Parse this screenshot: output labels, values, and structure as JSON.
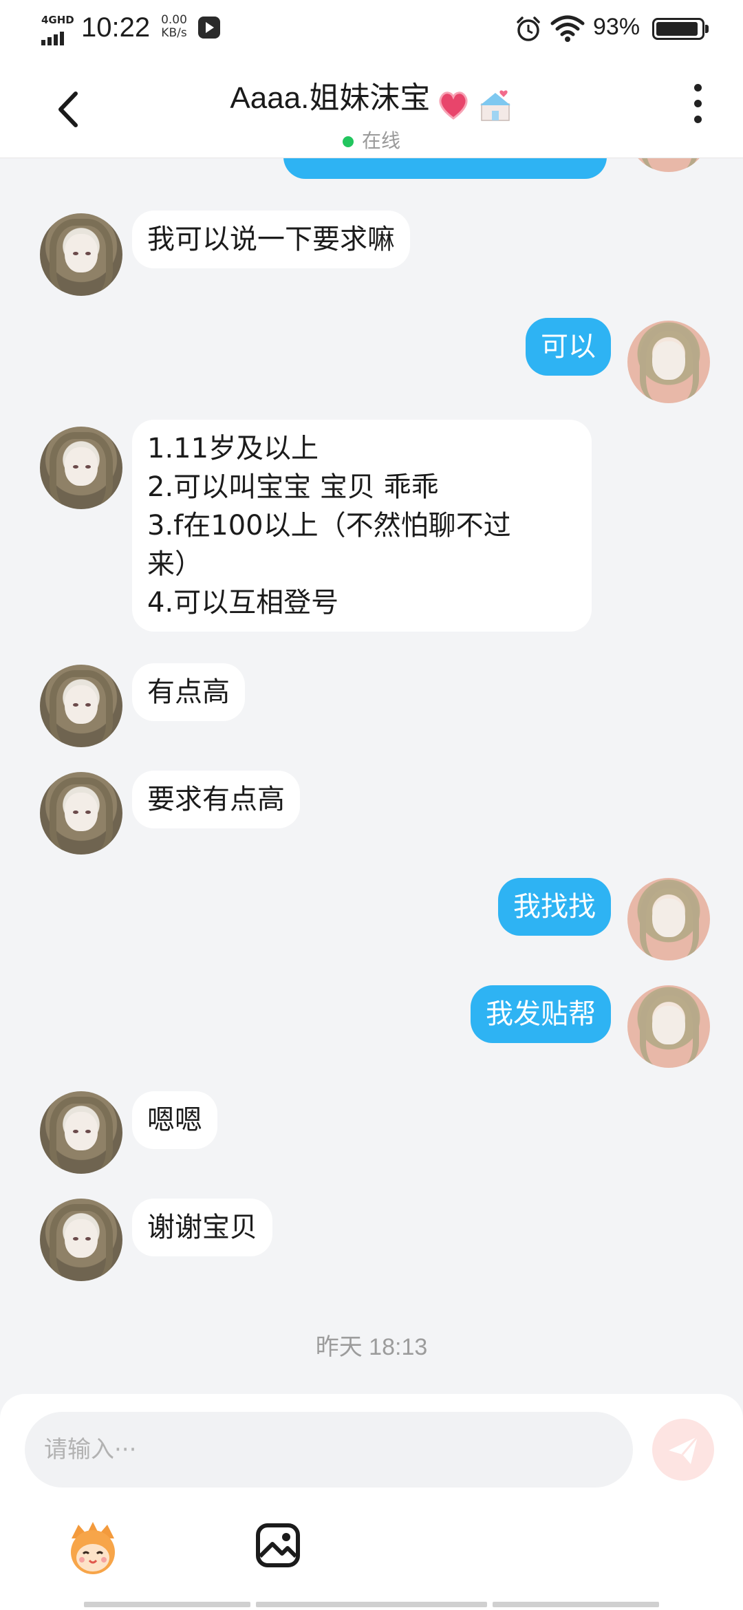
{
  "status_bar": {
    "network": "4GHD",
    "time": "10:22",
    "speed_value": "0.00",
    "speed_unit": "KB/s",
    "battery_percent": "93%",
    "battery_level": 0.93,
    "icons": [
      "signal-icon",
      "screen-record-icon",
      "alarm-icon",
      "wifi-icon",
      "battery-icon"
    ]
  },
  "header": {
    "title": "Aaaa.姐妹沫宝",
    "title_emoji": [
      "heart-icon",
      "wedding-icon"
    ],
    "status": "在线",
    "status_color": "#22c55e"
  },
  "messages": [
    {
      "side": "me",
      "text": ""
    },
    {
      "side": "other",
      "text": "我可以说一下要求嘛"
    },
    {
      "side": "me",
      "text": "可以"
    },
    {
      "side": "other",
      "text": "1.11岁及以上\n2.可以叫宝宝 宝贝 乖乖\n3.f在100以上（不然怕聊不过\n来）\n4.可以互相登号"
    },
    {
      "side": "other",
      "text": "有点高"
    },
    {
      "side": "other",
      "text": "要求有点高"
    },
    {
      "side": "me",
      "text": "我找找"
    },
    {
      "side": "me",
      "text": "我发贴帮"
    },
    {
      "side": "other",
      "text": "嗯嗯"
    },
    {
      "side": "other",
      "text": "谢谢宝贝"
    }
  ],
  "timestamp_separator": "昨天 18:13",
  "composer": {
    "placeholder": "请输入···",
    "value": ""
  },
  "colors": {
    "my_bubble": "#2eb3f3",
    "other_bubble": "#ffffff",
    "background": "#f3f4f6"
  }
}
